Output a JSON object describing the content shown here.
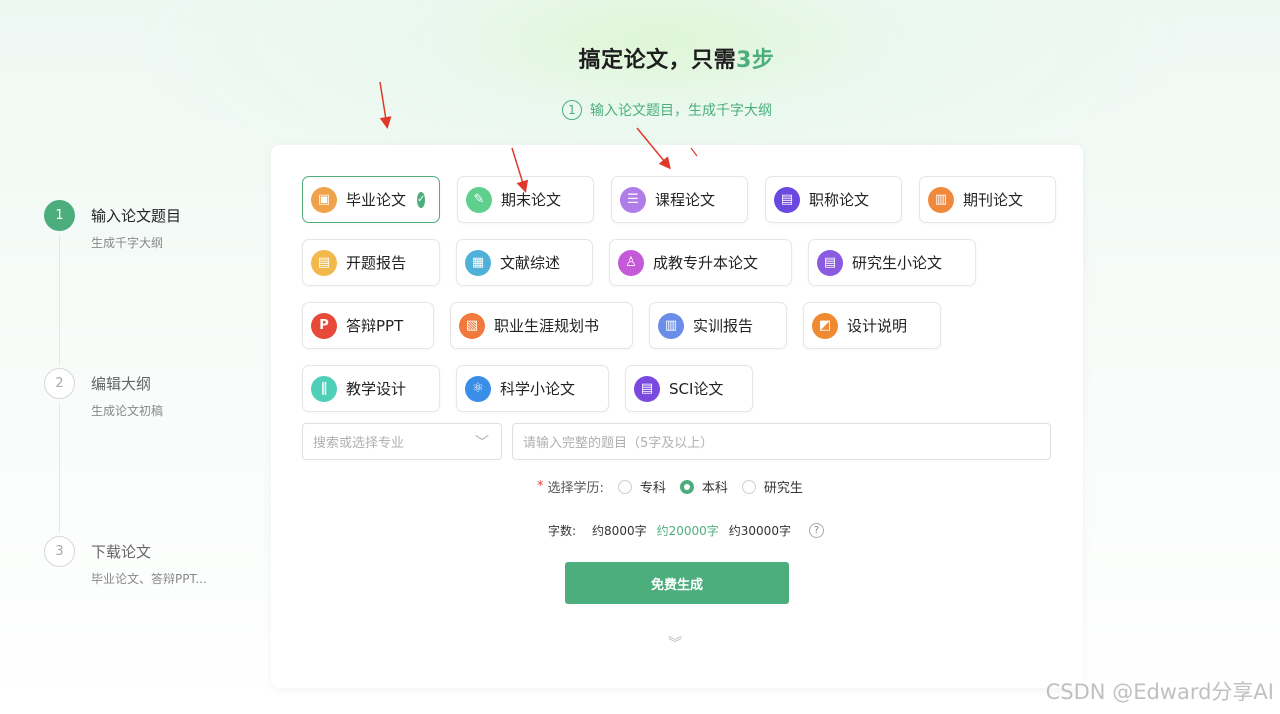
{
  "header": {
    "title_main": "搞定论文，只需",
    "title_accent": "3步",
    "substep_num": "1",
    "substep_text": "输入论文题目，生成千字大纲"
  },
  "steps": [
    {
      "num": "1",
      "title": "输入论文题目",
      "sub": "生成千字大纲"
    },
    {
      "num": "2",
      "title": "编辑大纲",
      "sub": "生成论文初稿"
    },
    {
      "num": "3",
      "title": "下载论文",
      "sub": "毕业论文、答辩PPT..."
    }
  ],
  "paper_types": {
    "row1": [
      {
        "label": "毕业论文",
        "color": "#f0a24a",
        "glyph": "▣",
        "selected": true
      },
      {
        "label": "期末论文",
        "color": "#5fcf8e",
        "glyph": "✎"
      },
      {
        "label": "课程论文",
        "color": "#b07ce8",
        "glyph": "☰"
      },
      {
        "label": "职称论文",
        "color": "#6b48e0",
        "glyph": "▤"
      },
      {
        "label": "期刊论文",
        "color": "#ef8a3c",
        "glyph": "▥"
      }
    ],
    "row2": [
      {
        "label": "开题报告",
        "color": "#f3b84a",
        "glyph": "▤"
      },
      {
        "label": "文献综述",
        "color": "#4fb0d8",
        "glyph": "▦"
      },
      {
        "label": "成教专升本论文",
        "color": "#c45ad8",
        "glyph": "♙"
      },
      {
        "label": "研究生小论文",
        "color": "#8a5ae0",
        "glyph": "▤"
      }
    ],
    "row3": [
      {
        "label": "答辩PPT",
        "color": "#e84a3a",
        "glyph": "P"
      },
      {
        "label": "职业生涯规划书",
        "color": "#ef7a3c",
        "glyph": "▧"
      },
      {
        "label": "实训报告",
        "color": "#6a8ee8",
        "glyph": "▥"
      },
      {
        "label": "设计说明",
        "color": "#f08a30",
        "glyph": "◩"
      }
    ],
    "row4": [
      {
        "label": "教学设计",
        "color": "#4fcfb8",
        "glyph": "∥"
      },
      {
        "label": "科学小论文",
        "color": "#3a8ee8",
        "glyph": "⚛"
      },
      {
        "label": "SCI论文",
        "color": "#7a4ae0",
        "glyph": "▤"
      }
    ]
  },
  "form": {
    "major_placeholder": "搜索或选择专业",
    "title_placeholder": "请输入完整的题目（5字及以上）",
    "degree_required_mark": "*",
    "degree_label": "选择学历:",
    "degree_options": [
      "专科",
      "本科",
      "研究生"
    ],
    "degree_selected": "本科",
    "words_label": "字数:",
    "words_options": [
      "约8000字",
      "约20000字",
      "约30000字"
    ],
    "words_selected": "约20000字",
    "help": "?",
    "generate_button": "免费生成"
  },
  "watermark": "CSDN @Edward分享AI",
  "colors": {
    "accent": "#4dae7d",
    "annotation_arrow": "#e0392b"
  }
}
